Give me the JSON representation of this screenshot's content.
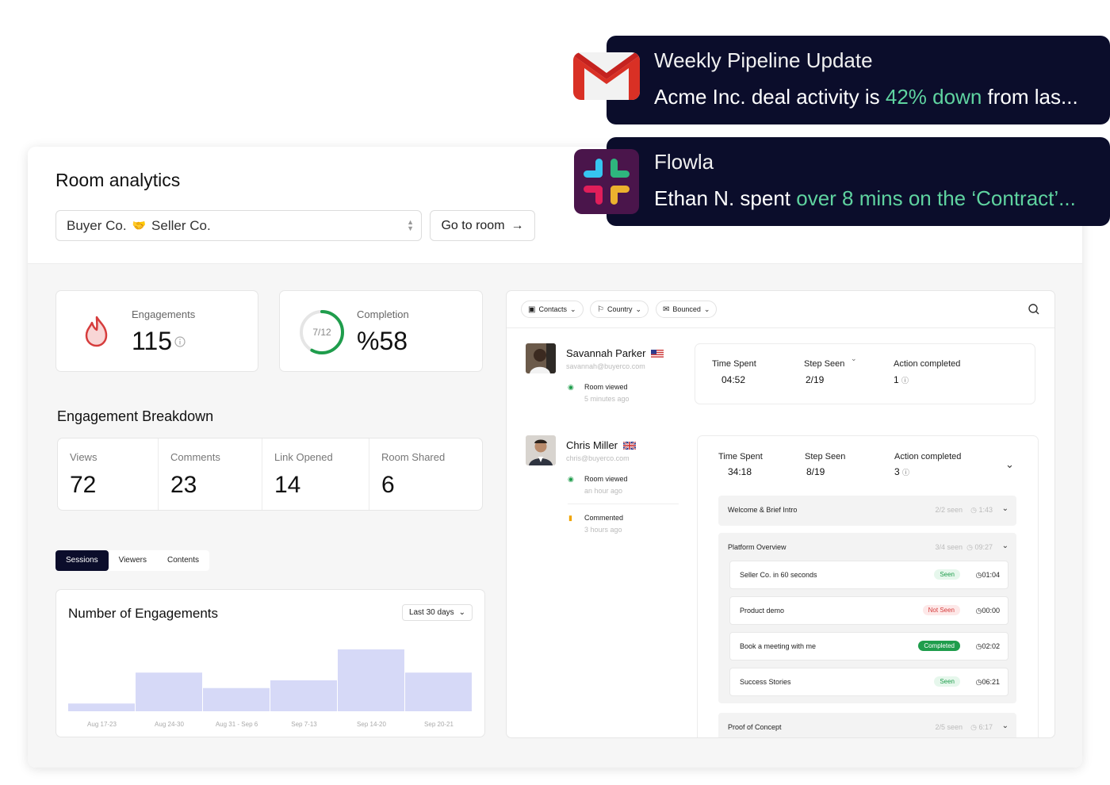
{
  "title": "Room analytics",
  "room_select": {
    "buyer": "Buyer Co.",
    "seller": "Seller Co."
  },
  "goto_button": "Go to room",
  "engagements": {
    "label": "Engagements",
    "value": "115"
  },
  "completion": {
    "label": "Completion",
    "value": "%58",
    "ring_label": "7/12",
    "fraction": 0.58
  },
  "breakdown": {
    "title": "Engagement Breakdown",
    "cells": [
      {
        "label": "Views",
        "value": "72"
      },
      {
        "label": "Comments",
        "value": "23"
      },
      {
        "label": "Link Opened",
        "value": "14"
      },
      {
        "label": "Room Shared",
        "value": "6"
      }
    ]
  },
  "tabs": [
    "Sessions",
    "Viewers",
    "Contents"
  ],
  "chart": {
    "title": "Number of Engagements",
    "range": "Last 30 days"
  },
  "chart_data": {
    "type": "bar",
    "title": "Number of Engagements",
    "categories": [
      "Aug 17-23",
      "Aug 24-30",
      "Aug 31 - Sep 6",
      "Sep 7-13",
      "Sep 14-20",
      "Sep 20-21"
    ],
    "values": [
      1,
      5,
      3,
      4,
      8,
      5
    ],
    "ylim": [
      0,
      8
    ]
  },
  "filters": [
    {
      "icon": "contacts-icon",
      "label": "Contacts"
    },
    {
      "icon": "flag-icon",
      "label": "Country"
    },
    {
      "icon": "bounced-icon",
      "label": "Bounced"
    }
  ],
  "contacts": [
    {
      "name": "Savannah Parker",
      "email": "savannah@buyerco.com",
      "flag": "us-flag-icon",
      "activity": [
        {
          "label": "Room viewed",
          "time": "5 minutes ago"
        }
      ],
      "time_spent_label": "Time Spent",
      "time_spent": "04:52",
      "step_seen_label": "Step Seen",
      "step_seen": "2/19",
      "action_label": "Action completed",
      "action": "1"
    },
    {
      "name": "Chris Miller",
      "email": "chris@buyerco.com",
      "flag": "uk-flag-icon",
      "activity": [
        {
          "label": "Room viewed",
          "time": "an hour ago"
        },
        {
          "label": "Commented",
          "time": "3 hours ago"
        }
      ],
      "time_spent_label": "Time Spent",
      "time_spent": "34:18",
      "step_seen_label": "Step Seen",
      "step_seen": "8/19",
      "action_label": "Action completed",
      "action": "3"
    }
  ],
  "steps": [
    {
      "name": "Welcome & Brief Intro",
      "seen": "2/2 seen",
      "duration": "1:43"
    },
    {
      "name": "Platform Overview",
      "seen": "3/4 seen",
      "duration": "09:27"
    },
    {
      "name": "Proof of Concept",
      "seen": "2/5 seen",
      "duration": "6:17"
    }
  ],
  "sub_items": [
    {
      "name": "Seller Co. in 60 seconds",
      "status": "Seen",
      "time": "01:04"
    },
    {
      "name": "Product demo",
      "status": "Not Seen",
      "time": "00:00"
    },
    {
      "name": "Book a meeting with me",
      "status": "Completed",
      "time": "02:02"
    },
    {
      "name": "Success Stories",
      "status": "Seen",
      "time": "06:21"
    }
  ],
  "notifications": [
    {
      "app": "gmail-icon",
      "title": "Weekly Pipeline Update",
      "msg_pre": "Acme Inc. deal activity is ",
      "msg_hl": "42% down",
      "msg_post": " from las..."
    },
    {
      "app": "slack-icon",
      "title": "Flowla",
      "msg_pre": "Ethan N. spent ",
      "msg_hl": "over 8 mins on the ‘Contract’...",
      "msg_post": ""
    }
  ],
  "colors": {
    "navy": "#0b0d2b",
    "accent_green": "#5fd3a0",
    "bar": "#d6d9f7",
    "ring_green": "#1f9d4c"
  }
}
